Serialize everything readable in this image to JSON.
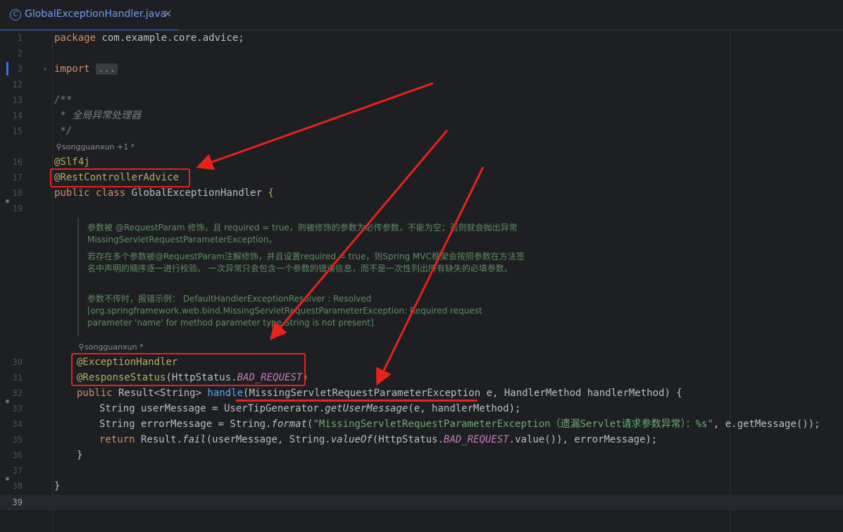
{
  "tab": {
    "title": "GlobalExceptionHandler.java",
    "icon": "class-icon",
    "close": "×"
  },
  "gutter": {
    "line_numbers": [
      "1",
      "2",
      "3",
      "12",
      "13",
      "14",
      "15",
      "16",
      "17",
      "18",
      "19",
      "30",
      "31",
      "32",
      "33",
      "34",
      "35",
      "36",
      "37",
      "38",
      "39"
    ],
    "current_line": "39"
  },
  "code": {
    "l1": {
      "kw": "package",
      "rest": " com.example.core.advice;"
    },
    "l3": {
      "kw": "import",
      "folded": "..."
    },
    "l13": "/**",
    "l14": " * 全局异常处理器",
    "l15": " */",
    "author1": "songguanxun +1 *",
    "l16": "@Slf4j",
    "l17": "@RestControllerAdvice",
    "l18": {
      "kw1": "public",
      "kw2": "class",
      "name": " GlobalExceptionHandler ",
      "brace": "{"
    },
    "doc": [
      "参数被 @RequestParam 修饰，且 required = true，则被修饰的参数为必传参数，不能为空；否则就会抛出异常 MissingServletRequestParameterException。",
      "若存在多个参数被@RequestParam注解修饰，并且设置required = true，则Spring MVC框架会按照参数在方法签名中声明的顺序逐一进行校验。 一次异常只会包含一个参数的错误信息，而不是一次性列出所有缺失的必填参数。",
      "参数不传时，报错示例： DefaultHandlerExceptionResolver : Resolved [org.springframework.web.bind.MissingServletRequestParameterException: Required request parameter 'name' for method parameter type String is not present]"
    ],
    "author2": "songguanxun *",
    "l30": "@ExceptionHandler",
    "l31": {
      "ann": "@ResponseStatus",
      "open": "(",
      "cls": "HttpStatus.",
      "const": "BAD_REQUEST",
      "close": ")"
    },
    "l32": {
      "kw": "public",
      "type": " Result<String> ",
      "fn": "handle",
      "params": "(MissingServletRequestParameterException e, HandlerMethod handlerMethod) {"
    },
    "l33": {
      "a": "String userMessage = UserTipGenerator.",
      "it": "getUserMessage",
      "b": "(e, handlerMethod);"
    },
    "l34": {
      "a": "String errorMessage = String.",
      "it": "format",
      "b": "(",
      "str": "\"MissingServletRequestParameterException（遗漏Servlet请求参数异常）：%s\"",
      "c": ", e.getMessage());"
    },
    "l35": {
      "kw": "return",
      "a": " Result.",
      "it1": "fail",
      "b": "(userMessage, String.",
      "it2": "valueOf",
      "c": "(HttpStatus.",
      "const": "BAD_REQUEST",
      "d": ".value()), errorMessage);"
    },
    "l36": "}",
    "l38": "}"
  },
  "colors": {
    "background": "#1e1f22",
    "keyword": "#cf8e6d",
    "annotation": "#b3ae60",
    "function": "#56a8f5",
    "string": "#6aab73",
    "doc": "#5d8d63",
    "highlight": "#e8221b",
    "accent": "#3574f0"
  }
}
